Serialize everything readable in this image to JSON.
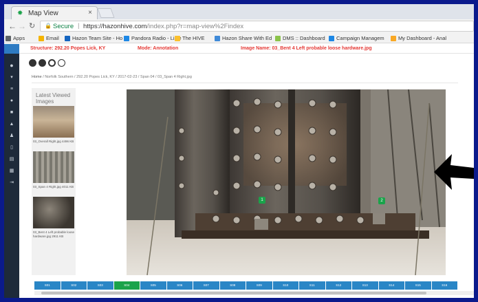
{
  "browser": {
    "tab_title": "Map View",
    "tab_close": "×",
    "secure_label": "Secure",
    "url_host": "https://hazonhive.com",
    "url_rest": "/index.php?r=map-view%2Findex",
    "bookmarks": [
      {
        "label": "Apps",
        "color": "#5f6368"
      },
      {
        "label": "Email",
        "color": "#f4b400"
      },
      {
        "label": "Hazon Team Site - Ho",
        "color": "#1565c0"
      },
      {
        "label": "Pandora Radio - Liste",
        "color": "#1e88e5"
      },
      {
        "label": "The HIVE",
        "color": "#fbc02d"
      },
      {
        "label": "Hazon Share With Ed",
        "color": "#3f8ad8"
      },
      {
        "label": "DMS :: Dashboard",
        "color": "#8bc34a"
      },
      {
        "label": "Campaign Managem",
        "color": "#1e88e5"
      },
      {
        "label": "My Dashboard - Anal",
        "color": "#f9a825"
      }
    ]
  },
  "infobar": {
    "structure": "Structure: 292.20 Popes Lick, KY",
    "mode": "Mode: Annotation",
    "image_name": "Image Name: 03_Bent 4 Left probable loose hardware.jpg"
  },
  "breadcrumb": {
    "home": "Home",
    "path": " / Norfolk Southern / 292.20 Popes Lick, KY / 2017-02-23 / Span 04 / 03_Span 4 Right.jpg"
  },
  "latest": {
    "header": "Latest Viewed Images",
    "items": [
      {
        "caption": "03_Overall Right.jpg 4496 KB"
      },
      {
        "caption": "03_Span 4 Right.jpg 4011 KB"
      },
      {
        "caption": "03_Bent 4 Left probable loose hardware.jpg 2911 KB"
      }
    ]
  },
  "pager": {
    "pages": [
      "S01",
      "S02",
      "S03",
      "S04",
      "S05",
      "S06",
      "S07",
      "S08",
      "S09",
      "S10",
      "S11",
      "S12",
      "S13",
      "S14",
      "S15",
      "S16"
    ],
    "active": "S04"
  },
  "main_image": {
    "annotation_labels": [
      "1",
      "2"
    ],
    "annotation_color": "#1aa34a"
  },
  "colors": {
    "frame": "#0b1a8c",
    "sidenav": "#1e2a3a",
    "pager": "#2a86c6",
    "active": "#1aa34a",
    "alert_text": "#e53935"
  }
}
